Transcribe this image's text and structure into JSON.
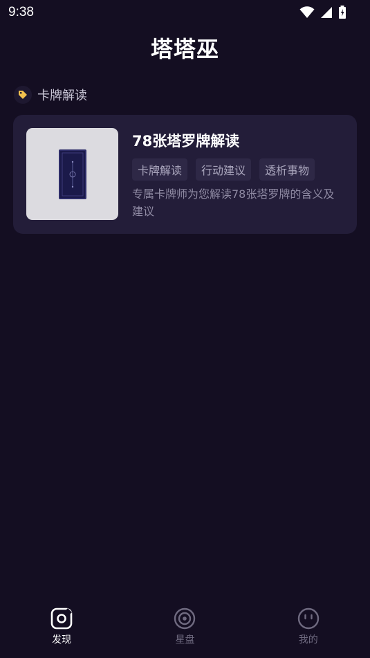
{
  "status_bar": {
    "time": "9:38",
    "icons": [
      "wifi-icon",
      "signal-icon",
      "battery-charging-icon"
    ]
  },
  "header": {
    "title": "塔塔巫"
  },
  "section": {
    "title": "卡牌解读",
    "icon": "tag-icon",
    "accent_color": "#f2c14e"
  },
  "card": {
    "title": "78张塔罗牌解读",
    "tags": [
      "卡牌解读",
      "行动建议",
      "透析事物"
    ],
    "description": "专属卡牌师为您解读78张塔罗牌的含义及建议"
  },
  "bottom_nav": {
    "items": [
      {
        "label": "发现",
        "icon": "discover-icon",
        "active": true
      },
      {
        "label": "星盘",
        "icon": "astrolabe-icon",
        "active": false
      },
      {
        "label": "我的",
        "icon": "profile-face-icon",
        "active": false
      }
    ]
  },
  "colors": {
    "background": "#140e22",
    "card_background": "#231d39",
    "tag_background": "#2e2846",
    "active_nav": "#ffffff",
    "inactive_nav": "#6f6a80"
  }
}
